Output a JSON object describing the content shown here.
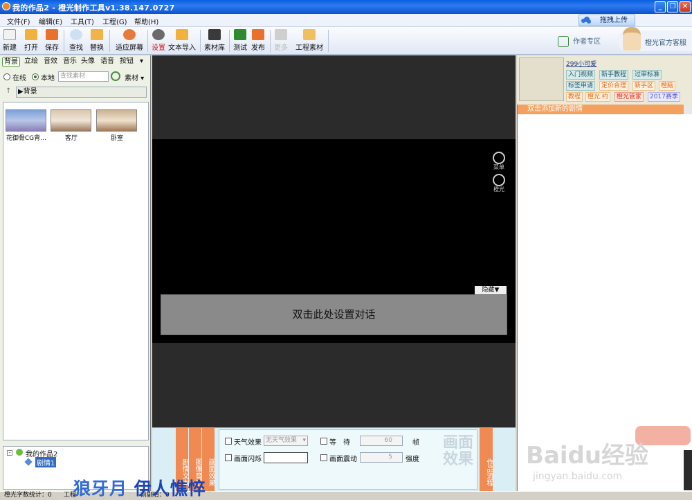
{
  "window": {
    "title": "我的作品2 - 橙光制作工具v1.38.147.0727"
  },
  "menu": [
    "文件(F)",
    "编辑(E)",
    "工具(T)",
    "工程(G)",
    "帮助(H)"
  ],
  "upload_label": "拖拽上传",
  "toolbar": {
    "new": "新建",
    "open": "打开",
    "save": "保存",
    "find": "查找",
    "replace": "替换",
    "fit": "适应屏幕",
    "settings": "设置",
    "text_import": "文本导入",
    "library": "素材库",
    "test": "测试",
    "publish": "发布",
    "disabled": "更多",
    "project_assets": "工程素材",
    "author_zone": "作者专区",
    "support": "橙光官方客服"
  },
  "left": {
    "tabs": [
      "背景",
      "立绘",
      "音效",
      "音乐",
      "头像",
      "语音",
      "按钮"
    ],
    "source_online": "在线",
    "source_local": "本地",
    "search_placeholder": "查找素材",
    "asset_dropdown": "素材",
    "path": "▶背景",
    "assets": [
      "花御骨CG背…",
      "客厅",
      "卧室"
    ],
    "tree_root": "我的作品2",
    "tree_child": "剧情1"
  },
  "stage": {
    "dialog_text": "双击此处设置对话",
    "hide_label": "隐藏▼",
    "menu_label": "菜单",
    "orange_label": "橙光"
  },
  "fx": {
    "vtab1": "剧情文本",
    "vtab2": "图像音乐",
    "vtab3": "画面效果",
    "vtab4": "作品流程",
    "weather": "天气效果",
    "weather_value": "无天气效果",
    "flash": "画面闪烁",
    "wait": "等　待",
    "wait_value": "60",
    "frame_unit": "帧",
    "shake": "画面震动",
    "shake_value": "5",
    "strength_unit": "强度",
    "big_label": "画面效果"
  },
  "right": {
    "username": "299小可爱",
    "tags": [
      {
        "label": "入门视频",
        "style": ""
      },
      {
        "label": "新手教程",
        "style": ""
      },
      {
        "label": "过审标准",
        "style": ""
      },
      {
        "label": "标签申请",
        "style": ""
      },
      {
        "label": "定价合理",
        "style": "orange"
      },
      {
        "label": "新手区",
        "style": "orange"
      },
      {
        "label": "橙脑",
        "style": "orange"
      },
      {
        "label": "教程",
        "style": "orange"
      },
      {
        "label": "橙光.约",
        "style": "orange"
      },
      {
        "label": "橙光管家",
        "style": "red"
      },
      {
        "label": "2017赛季",
        "style": "purple"
      }
    ],
    "add_plot": "双击添加新的剧情"
  },
  "watermark": {
    "logo": "Baidu经验",
    "url": "jingyan.baidu.com"
  },
  "overlay": {
    "part1": "狼牙月",
    "part2": "伊人憔悴"
  },
  "status": {
    "text1": "橙光字数统计：0",
    "text2": "工程",
    "text3": "前剧情：0"
  }
}
